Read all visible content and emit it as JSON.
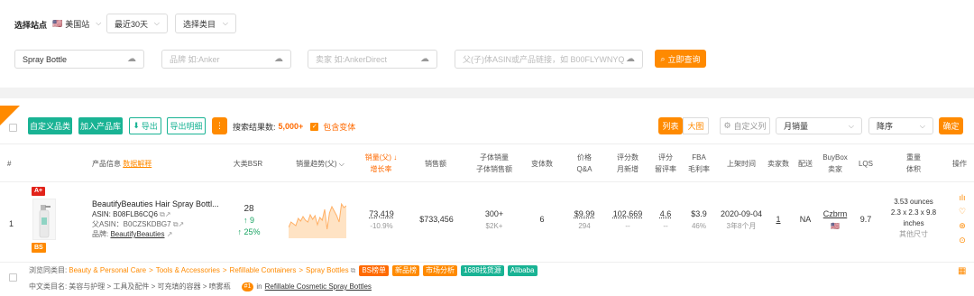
{
  "filters": {
    "site_label": "选择站点",
    "site_flag": "🇺🇸",
    "site_value": "美国站",
    "period": "最近30天",
    "category": "选择类目",
    "keyword_value": "Spray Bottle",
    "brand_placeholder": "品牌 如:Anker",
    "seller_placeholder": "卖家 如:AnkerDirect",
    "asin_placeholder": "父(子)体ASIN或产品链接，如 B00FLYWNYQ",
    "query_button": "立即查询"
  },
  "toolbar": {
    "custom_category": "自定义品类",
    "add_to_lib": "加入产品库",
    "export": "导出",
    "export_detail": "导出明细",
    "more": "⋮",
    "result_label": "搜索结果数:",
    "result_count": "5,000+",
    "include_variants": "包含变体",
    "view_list": "列表",
    "view_grid": "大图",
    "custom_columns": "自定义列",
    "sort_field": "月销量",
    "sort_order": "降序",
    "confirm": "确定"
  },
  "columns": {
    "index": "#",
    "product_info": "产品信息",
    "data_explain": "数据解释",
    "bsr": "大类BSR",
    "trend": "销量趋势(父)",
    "sales_growth_1": "销量(父)",
    "sales_growth_2": "增长率",
    "revenue": "销售额",
    "child_sales_1": "子体销量",
    "child_sales_2": "子体销售额",
    "variants": "变体数",
    "price_1": "价格",
    "price_2": "Q&A",
    "ratings_1": "评分数",
    "ratings_2": "月新增",
    "rating_1": "评分",
    "rating_2": "留评率",
    "fba_1": "FBA",
    "fba_2": "毛利率",
    "launch": "上架时间",
    "sellers": "卖家数",
    "delivery": "配送",
    "buybox_1": "BuyBox",
    "buybox_2": "卖家",
    "lqs": "LQS",
    "weight_1": "重量",
    "weight_2": "体积",
    "actions": "操作"
  },
  "row": {
    "index": "1",
    "badge_top": "A+",
    "badge_bottom": "BS",
    "title": "BeautifyBeauties Hair Spray Bottl...",
    "asin_label": "ASIN: ",
    "asin": "B08FLB6CQ6",
    "parent_label": "父ASIN：",
    "parent_asin": "B0CZSKDBG7",
    "brand_label": "品牌: ",
    "brand": "BeautifyBeauties",
    "bsr": "28",
    "bsr_change": "↑ 9",
    "bsr_pct": "↑ 25%",
    "trend_values": [
      32,
      38,
      36,
      34,
      42,
      39,
      44,
      40,
      38,
      46,
      41,
      45,
      35,
      43,
      40,
      52,
      30,
      48,
      55,
      50,
      45,
      38,
      58,
      54,
      56
    ],
    "sales": "73,419",
    "growth": "-10.9%",
    "revenue": "$733,456",
    "child_sales": "300+",
    "child_revenue": "$2K+",
    "variants": "6",
    "price": "$9.99",
    "qa": "294",
    "ratings": "102,669",
    "ratings_new": "--",
    "rating": "4.6",
    "review_rate": "--",
    "fba": "$3.9",
    "margin": "46%",
    "launch_date": "2020-09-04",
    "launch_age": "3年8个月",
    "sellers": "1",
    "delivery": "NA",
    "buybox_seller": "Czbrm",
    "buybox_flag": "🇺🇸",
    "lqs": "9.7",
    "weight": "3.53 ounces",
    "dims": "2.3 x 2.3 x 9.8",
    "dims_unit": "inches",
    "other_size": "其他尺寸"
  },
  "browse": {
    "label": "浏览同类目:",
    "path": [
      "Beauty & Personal Care",
      "Tools & Accessories",
      "Refillable Containers",
      "Spray Bottles"
    ],
    "tags": [
      {
        "text": "BS榜单",
        "color": "#ff6a00"
      },
      {
        "text": "新品榜",
        "color": "#ff8a00"
      },
      {
        "text": "市场分析",
        "color": "#ff8a00"
      },
      {
        "text": "1688找货源",
        "color": "#19b394"
      },
      {
        "text": "Alibaba",
        "color": "#19b394"
      }
    ],
    "cn_label": "中文类目名:",
    "cn_path": "美容与护理 > 工具及配件 > 可充填的容器 > 喷雾瓶",
    "rank_badge": "#1",
    "rank_in": "in",
    "rank_cat": "Refillable Cosmetic Spray Bottles"
  },
  "colors": {
    "accent": "#ff8a00",
    "green": "#19b394"
  }
}
